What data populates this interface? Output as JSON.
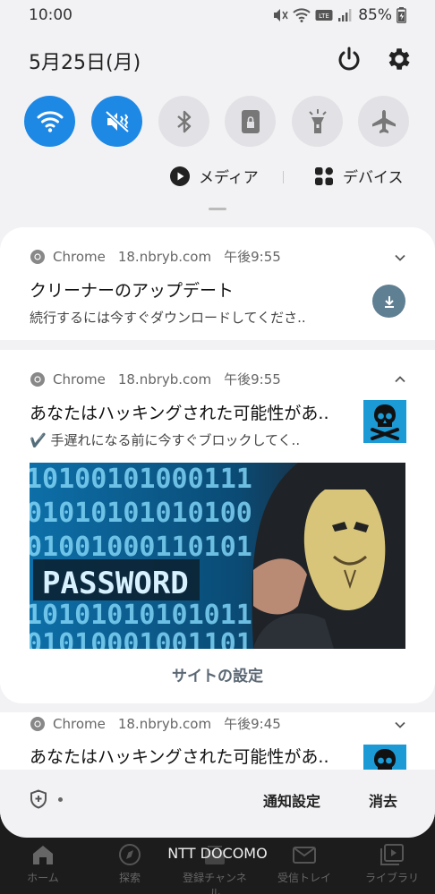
{
  "status_bar": {
    "time": "10:00",
    "battery": "85%"
  },
  "quick_panel": {
    "date": "5月25日(月)",
    "tiles": [
      {
        "name": "wifi-tile",
        "icon": "wifi-icon",
        "state": "on"
      },
      {
        "name": "sound-tile",
        "icon": "vibrate-mute-icon",
        "state": "on"
      },
      {
        "name": "bluetooth-tile",
        "icon": "bluetooth-icon",
        "state": "off"
      },
      {
        "name": "rotation-lock-tile",
        "icon": "lock-screen-icon",
        "state": "off"
      },
      {
        "name": "flashlight-tile",
        "icon": "flashlight-icon",
        "state": "off"
      },
      {
        "name": "airplane-tile",
        "icon": "airplane-icon",
        "state": "off"
      }
    ],
    "media_label": "メディア",
    "devices_label": "デバイス",
    "colors": {
      "tile_on": "#1e88e5",
      "tile_off": "#e2e2e6"
    }
  },
  "notifications": [
    {
      "app": "Chrome",
      "host": "18.nbryb.com",
      "time": "午後9:55",
      "title": "クリーナーのアップデート",
      "body": "続行するには今すぐダウンロードしてくださ..",
      "action_icon": "download-icon"
    },
    {
      "app": "Chrome",
      "host": "18.nbryb.com",
      "time": "午後9:55",
      "title": "あなたはハッキングされた可能性があ..",
      "body": "✔️ 手遅れになる前に今すぐブロックしてく..",
      "image_text": "PASSWORD",
      "action": "サイトの設定"
    },
    {
      "app": "Chrome",
      "host": "18.nbryb.com",
      "time": "午後9:45",
      "title": "あなたはハッキングされた可能性があ.."
    }
  ],
  "bottom_bar": {
    "notification_settings": "通知設定",
    "clear": "消去"
  },
  "behind": {
    "carrier": "NTT DOCOMO",
    "nav": [
      "ホーム",
      "探索",
      "登録チャンネル",
      "受信トレイ",
      "ライブラリ"
    ]
  }
}
